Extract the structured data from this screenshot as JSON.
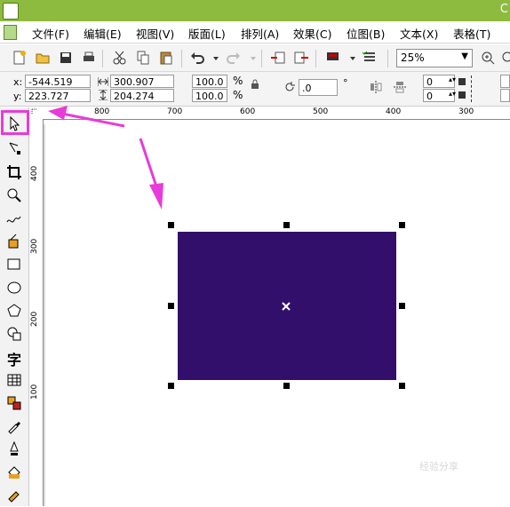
{
  "title_bar": {
    "text": "C"
  },
  "menu": {
    "items": [
      "文件(F)",
      "编辑(E)",
      "视图(V)",
      "版面(L)",
      "排列(A)",
      "效果(C)",
      "位图(B)",
      "文本(X)",
      "表格(T)"
    ]
  },
  "toolbar": {
    "zoom_value": "25%"
  },
  "property_bar": {
    "x_label": "x:",
    "x_value": "-544.519 mm",
    "y_label": "y:",
    "y_value": "223.727 mm",
    "width_value": "300.907 mm",
    "height_value": "204.274 mm",
    "scale_x": "100.0",
    "scale_y": "100.0",
    "percent": "%",
    "rotation_value": ".0",
    "degree": "°",
    "pos_a": "0",
    "pos_b": "0"
  },
  "ruler_top": {
    "labels": [
      "800",
      "700",
      "600",
      "500",
      "400",
      "300"
    ]
  },
  "ruler_left": {
    "labels": [
      "400",
      "300",
      "200",
      "100"
    ]
  },
  "toolbox": {
    "text_tool_glyph": "字"
  },
  "canvas": {
    "rectangle_color": "#330f6c",
    "highlight_color": "#e83bd8",
    "watermark": "经验分享"
  }
}
